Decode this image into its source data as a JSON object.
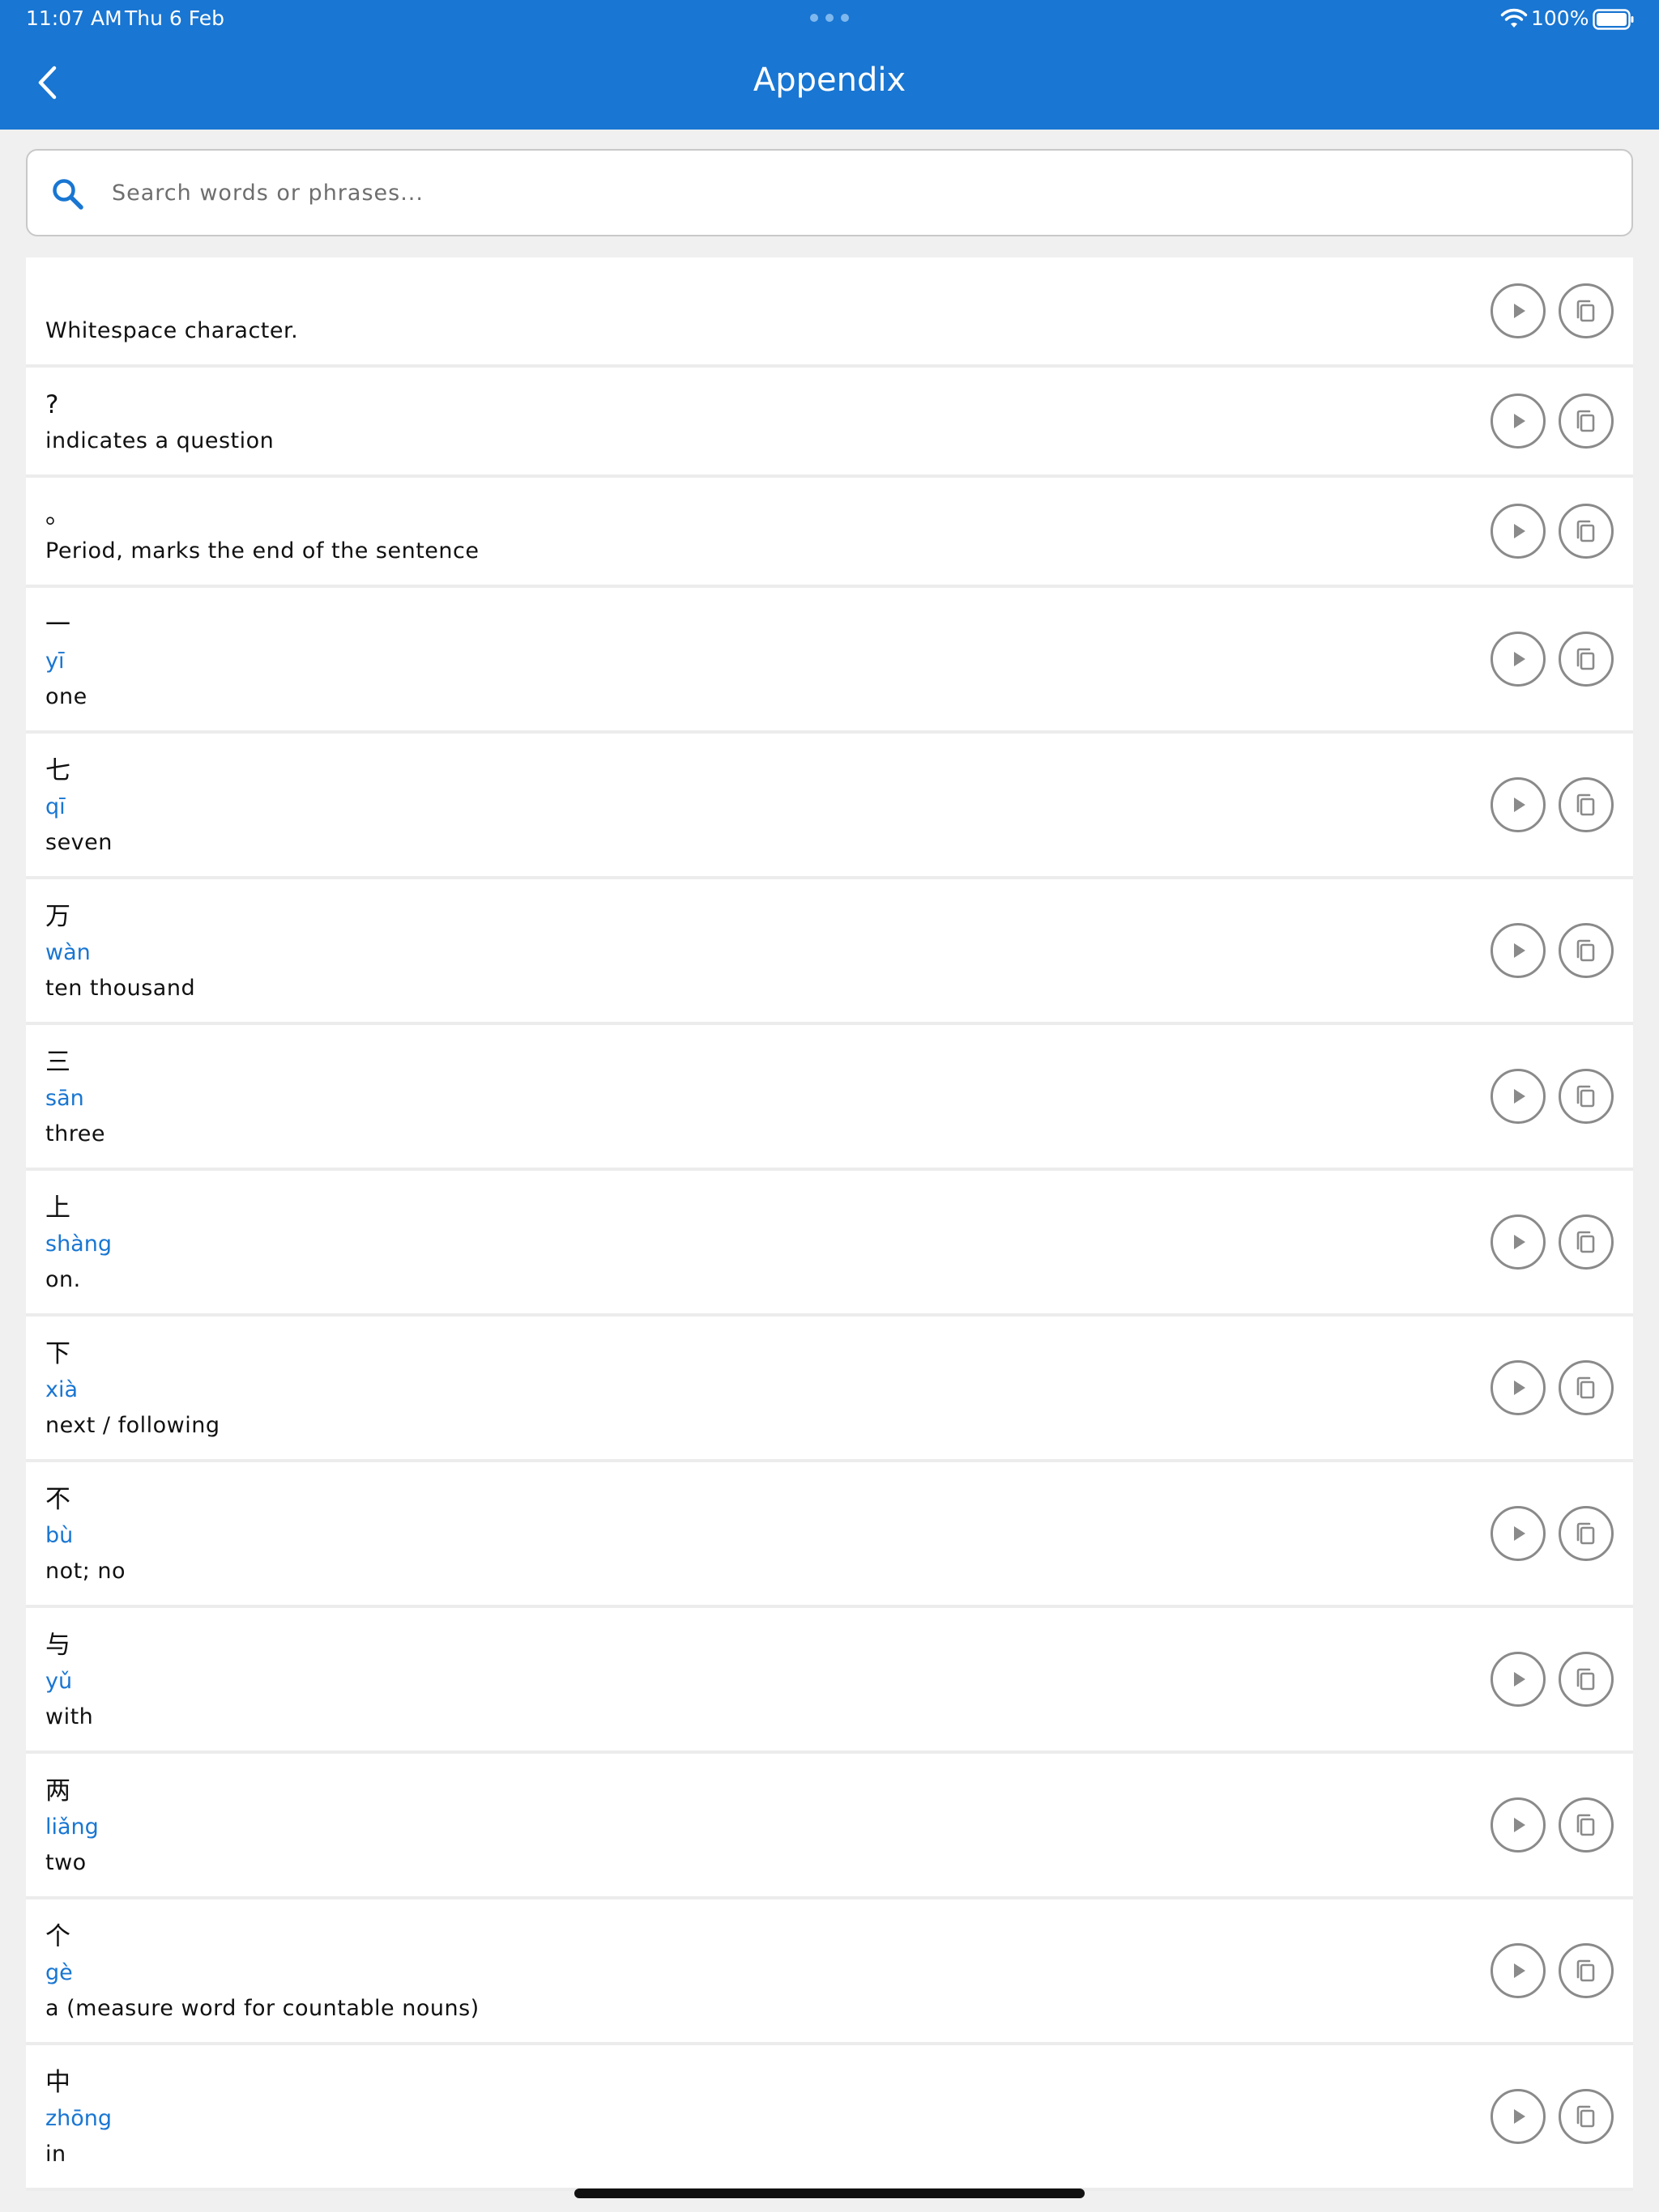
{
  "status_bar": {
    "time": "11:07 AM",
    "date": "Thu 6 Feb",
    "battery": "100%"
  },
  "header": {
    "title": "Appendix",
    "back_icon": "chevron-left-icon"
  },
  "search": {
    "placeholder": "Search words or phrases...",
    "icon": "search-icon"
  },
  "colors": {
    "header": "#1976d2",
    "pinyin": "#1976d2",
    "background": "#f0f0f0"
  },
  "items": [
    {
      "hanzi": " ",
      "pinyin": "",
      "meaning": "Whitespace character."
    },
    {
      "hanzi": "?",
      "pinyin": "",
      "meaning": "indicates a question"
    },
    {
      "hanzi": "。",
      "pinyin": "",
      "meaning": "Period, marks the end of the sentence"
    },
    {
      "hanzi": "一",
      "pinyin": "yī",
      "meaning": "one"
    },
    {
      "hanzi": "七",
      "pinyin": "qī",
      "meaning": "seven"
    },
    {
      "hanzi": "万",
      "pinyin": "wàn",
      "meaning": "ten thousand"
    },
    {
      "hanzi": "三",
      "pinyin": "sān",
      "meaning": "three"
    },
    {
      "hanzi": "上",
      "pinyin": "shàng",
      "meaning": "on."
    },
    {
      "hanzi": "下",
      "pinyin": "xià",
      "meaning": "next / following"
    },
    {
      "hanzi": "不",
      "pinyin": "bù",
      "meaning": "not; no"
    },
    {
      "hanzi": "与",
      "pinyin": "yǔ",
      "meaning": "with"
    },
    {
      "hanzi": "两",
      "pinyin": "liǎng",
      "meaning": "two"
    },
    {
      "hanzi": "个",
      "pinyin": "gè",
      "meaning": "a (measure word for countable nouns)"
    },
    {
      "hanzi": "中",
      "pinyin": "zhōng",
      "meaning": "in"
    }
  ],
  "item_actions": {
    "play_icon": "play-icon",
    "copy_icon": "copy-icon"
  }
}
